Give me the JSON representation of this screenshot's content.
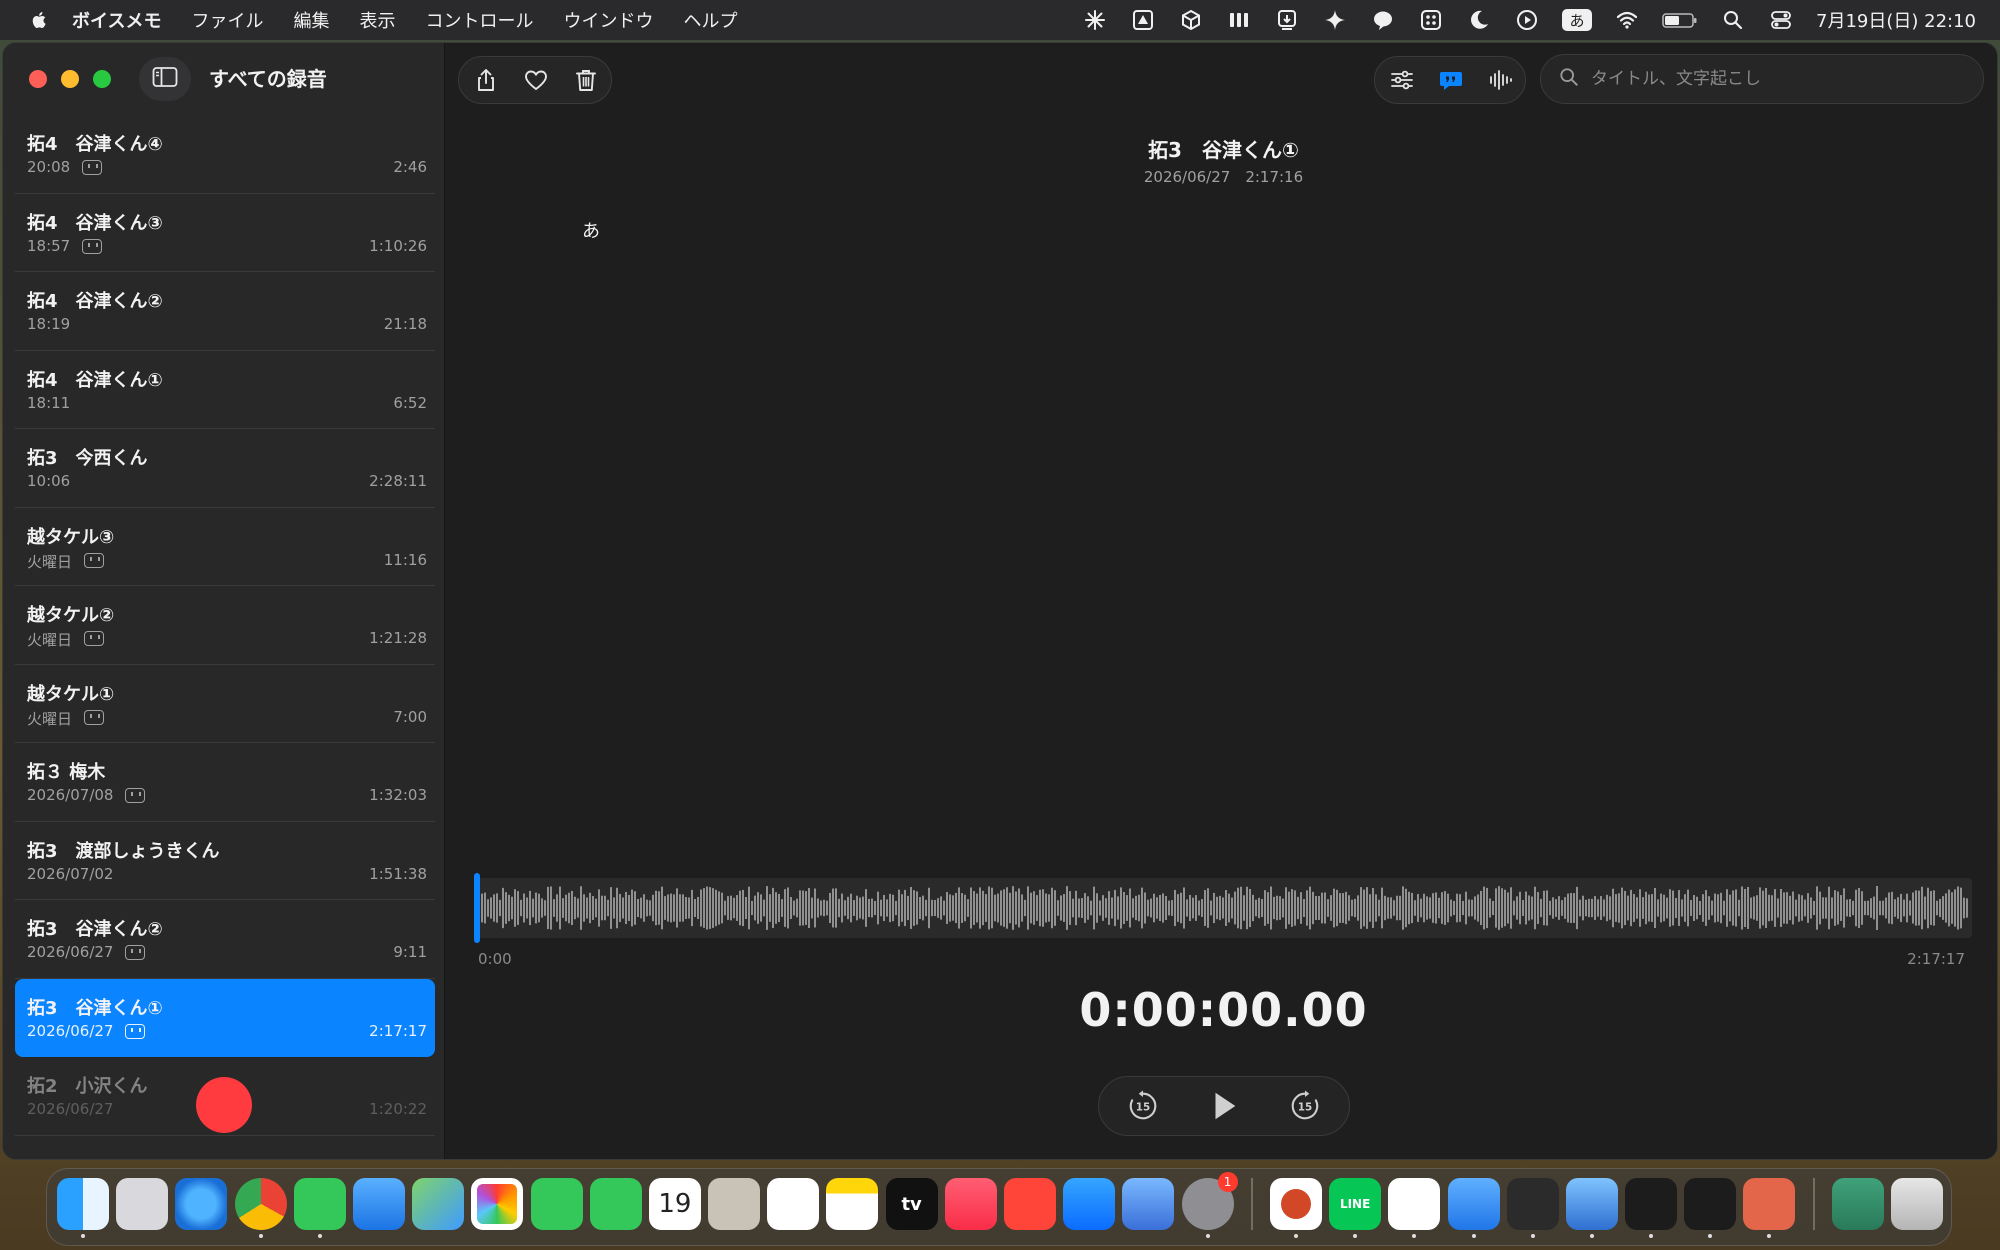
{
  "menubar": {
    "app_name": "ボイスメモ",
    "items": [
      "ファイル",
      "編集",
      "表示",
      "コントロール",
      "ウインドウ",
      "ヘルプ"
    ],
    "ime_label": "あ",
    "clock": "7月19日(日) 22:10"
  },
  "sidebar": {
    "title": "すべての録音",
    "recordings": [
      {
        "title": "拓4　谷津くん④",
        "date": "20:08",
        "has_transcript": true,
        "duration": "2:46"
      },
      {
        "title": "拓4　谷津くん③",
        "date": "18:57",
        "has_transcript": true,
        "duration": "1:10:26"
      },
      {
        "title": "拓4　谷津くん②",
        "date": "18:19",
        "has_transcript": false,
        "duration": "21:18"
      },
      {
        "title": "拓4　谷津くん①",
        "date": "18:11",
        "has_transcript": false,
        "duration": "6:52"
      },
      {
        "title": "拓3　今西くん",
        "date": "10:06",
        "has_transcript": false,
        "duration": "2:28:11"
      },
      {
        "title": "越タケル③",
        "date": "火曜日",
        "has_transcript": true,
        "duration": "11:16"
      },
      {
        "title": "越タケル②",
        "date": "火曜日",
        "has_transcript": true,
        "duration": "1:21:28"
      },
      {
        "title": "越タケル①",
        "date": "火曜日",
        "has_transcript": true,
        "duration": "7:00"
      },
      {
        "title": "拓３ 梅木",
        "date": "2026/07/08",
        "has_transcript": true,
        "duration": "1:32:03"
      },
      {
        "title": "拓3　渡部しょうきくん",
        "date": "2026/07/02",
        "has_transcript": false,
        "duration": "1:51:38"
      },
      {
        "title": "拓3　谷津くん②",
        "date": "2026/06/27",
        "has_transcript": true,
        "duration": "9:11"
      },
      {
        "title": "拓3　谷津くん①",
        "date": "2026/06/27",
        "has_transcript": true,
        "duration": "2:17:17",
        "selected": true
      },
      {
        "title": "拓2　小沢くん",
        "date": "2026/06/27",
        "has_transcript": false,
        "duration": "1:20:22",
        "dimmed": true
      }
    ]
  },
  "toolbar": {
    "left_icons": [
      "share-icon",
      "heart-icon",
      "trash-icon"
    ],
    "right_icons": [
      "sliders-icon",
      "transcript-icon",
      "waveform-icon"
    ],
    "search_placeholder": "タイトル、文字起こし"
  },
  "detail": {
    "title": "拓3　谷津くん①",
    "datetime": "2026/06/27　2:17:16",
    "transcript_text": "あ",
    "time_start": "0:00",
    "time_end": "2:17:17",
    "timer": "0:00:00.00",
    "playhead_position": 0
  },
  "dock": {
    "calendar_day": "19",
    "tv_label": "tv",
    "settings_badge": "1",
    "line_label": "LINE"
  },
  "colors": {
    "accent": "#0a84ff",
    "record": "#ff3b3f",
    "window_bg": "#1e1e1e",
    "sidebar_bg": "#282828"
  }
}
